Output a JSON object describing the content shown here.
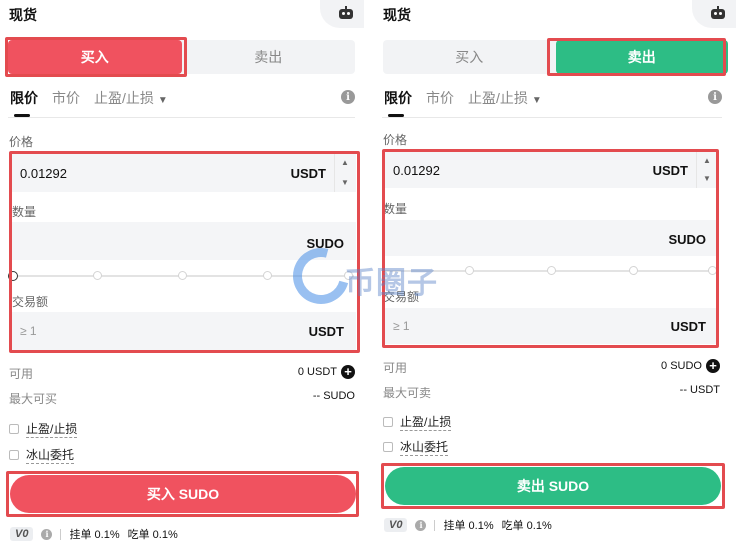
{
  "left": {
    "title": "现货",
    "tabs": {
      "buy": "买入",
      "sell": "卖出"
    },
    "order_types": {
      "limit": "限价",
      "market": "市价",
      "tpsl": "止盈/止损"
    },
    "price": {
      "label": "价格",
      "value": "0.01292",
      "unit": "USDT"
    },
    "amount": {
      "label": "数量",
      "value": "",
      "unit": "SUDO"
    },
    "total": {
      "label": "交易额",
      "placeholder": "≥ 1",
      "unit": "USDT"
    },
    "available": {
      "label": "可用",
      "value": "0 USDT"
    },
    "max": {
      "label": "最大可买",
      "value": "-- SUDO"
    },
    "checks": {
      "tpsl": "止盈/止损",
      "iceberg": "冰山委托"
    },
    "action_button": "买入 SUDO",
    "footer": {
      "vip": "V0",
      "maker": "挂单 0.1%",
      "taker": "吃单 0.1%"
    }
  },
  "right": {
    "title": "现货",
    "tabs": {
      "buy": "买入",
      "sell": "卖出"
    },
    "order_types": {
      "limit": "限价",
      "market": "市价",
      "tpsl": "止盈/止损"
    },
    "price": {
      "label": "价格",
      "value": "0.01292",
      "unit": "USDT"
    },
    "amount": {
      "label": "数量",
      "value": "",
      "unit": "SUDO"
    },
    "total": {
      "label": "交易额",
      "placeholder": "≥ 1",
      "unit": "USDT"
    },
    "available": {
      "label": "可用",
      "value": "0 SUDO"
    },
    "max": {
      "label": "最大可卖",
      "value": "-- USDT"
    },
    "checks": {
      "tpsl": "止盈/止损",
      "iceberg": "冰山委托"
    },
    "action_button": "卖出 SUDO",
    "footer": {
      "vip": "V0",
      "maker": "挂单 0.1%",
      "taker": "吃单 0.1%"
    }
  },
  "watermark": "币圈子",
  "colors": {
    "buy": "#f0525f",
    "sell": "#2dbd85",
    "highlight": "#e34b4f"
  }
}
